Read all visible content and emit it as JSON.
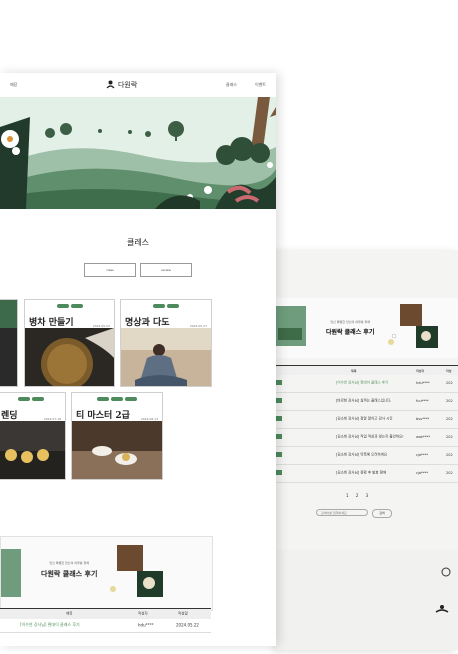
{
  "front": {
    "nav": {
      "left": "매장",
      "logo": "다원락",
      "center": "클래스",
      "right": "이벤트"
    },
    "section_title": "클레스",
    "filters": [
      "class",
      "review"
    ],
    "cards": [
      {
        "title": "병차 만들기",
        "date": "2024.05.22"
      },
      {
        "title": "명상과 다도",
        "date": "2024.05.27"
      },
      {
        "title": "렌딩",
        "date": "2024.07.18"
      },
      {
        "title": "티 마스터 2급",
        "date": "2024.08.13"
      }
    ],
    "banner": {
      "sub": "당신 특별한 당신의 하루를 위해",
      "main": "다원락 클래스 후기"
    },
    "table_head": {
      "title": "제목",
      "author": "작성자",
      "date": "작성일"
    },
    "rows": [
      {
        "title": "[이수연 강사님] 편데이 클래스 후기",
        "author": "hdu****",
        "date": "2024.05.22"
      }
    ]
  },
  "back": {
    "banner": {
      "sub": "당신 특별한 당신의 하루를 위해",
      "main": "다원락 클래스 후기"
    },
    "table_head": {
      "title": "제목",
      "author": "작성자",
      "date": "작성"
    },
    "rows": [
      {
        "title": "[이수연 강사님] 편데이 클래스 후기",
        "author": "hdu****",
        "date": "202",
        "green": true
      },
      {
        "title": "[바로현 강사님] 살까는 클래스입니다.",
        "author": "fuu****",
        "date": "202",
        "green": false
      },
      {
        "title": "[김소희 강사님] 정말 알차고 감사 시간",
        "author": "bsu****",
        "date": "202",
        "green": false
      },
      {
        "title": "[김소희 강사님] 직업 적성과 맞는지 불안하요!",
        "author": "wok****",
        "date": "202",
        "green": false
      },
      {
        "title": "[김소희 강사님] 뒤쪽에 오려하게요",
        "author": "cja****",
        "date": "202",
        "green": false
      },
      {
        "title": "[김소희 강사님] 정확 후 발효 함께",
        "author": "cja****",
        "date": "202",
        "green": false
      }
    ],
    "pager": "1 2 3",
    "search_placeholder": "검색어를 입력하세요",
    "search_button": "검색"
  }
}
